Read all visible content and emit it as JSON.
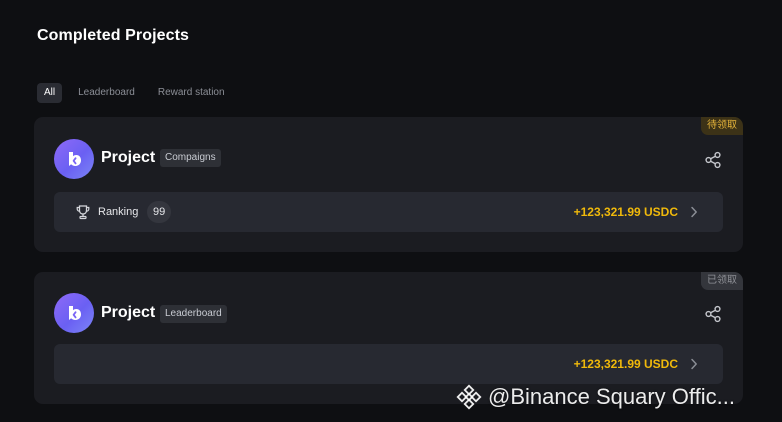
{
  "page": {
    "title": "Completed Projects"
  },
  "tabs": [
    {
      "label": "All",
      "active": true
    },
    {
      "label": "Leaderboard",
      "active": false
    },
    {
      "label": "Reward station",
      "active": false
    }
  ],
  "cards": [
    {
      "status": "待领取",
      "project_name": "Project",
      "tag": "Compaigns",
      "ranking_label": "Ranking",
      "ranking_value": "99",
      "amount": "+123,321.99 USDC",
      "share_icon": "share-icon",
      "avatar_icon": "project-logo"
    },
    {
      "status": "已领取",
      "project_name": "Project",
      "tag": "Leaderboard",
      "amount": "+123,321.99 USDC",
      "share_icon": "share-icon",
      "avatar_icon": "project-logo"
    }
  ],
  "watermark": {
    "text": "@Binance Squary Offic..."
  },
  "colors": {
    "background": "#0e0f12",
    "card": "#1b1c21",
    "row": "#272931",
    "accent_amount": "#f0b90b",
    "badge_pending": "#e4b33a",
    "avatar_gradient_start": "#8f6af7",
    "avatar_gradient_end": "#7c86f6"
  }
}
